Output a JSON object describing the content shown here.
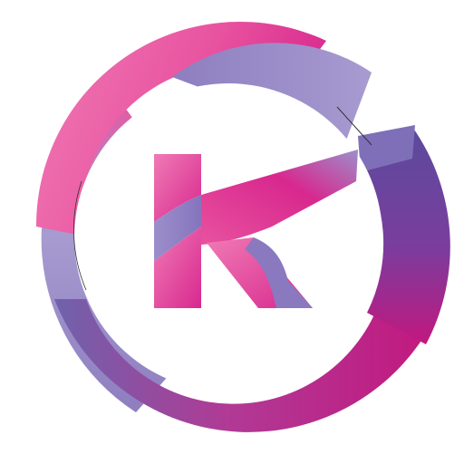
{
  "logo": {
    "description_icon": "stylized-g-k-monogram-icon",
    "colors": {
      "pink": "#e8529f",
      "hot_pink": "#d8288e",
      "magenta": "#c2187f",
      "purple": "#8e7ec0",
      "lavender": "#a79bd0",
      "deep_purple": "#5b4b9c",
      "background": "#ffffff"
    }
  }
}
